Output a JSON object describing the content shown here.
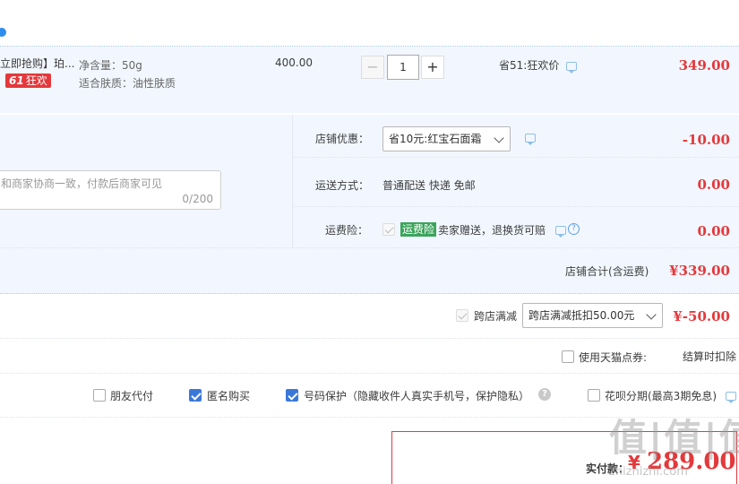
{
  "product": {
    "title": "立即抢购】珀...",
    "badge_number": "61",
    "badge_text": "狂欢",
    "net_content": "净含量：50g",
    "skin_type": "适合肤质：油性肤质",
    "unit_price": "400.00",
    "quantity": "1",
    "minus_label": "−",
    "plus_label": "+",
    "promo": "省51:狂欢价",
    "subtotal": "349.00"
  },
  "shop": {
    "coupon_label": "店铺优惠：",
    "coupon_select": "省10元:红宝石面霜",
    "coupon_amount": "-10.00",
    "shipping_label": "运送方式：",
    "shipping_value": "普通配送 快递 免邮",
    "shipping_amount": "0.00",
    "insurance_label": "运费险：",
    "insurance_tag": "运费险",
    "insurance_text": "卖家赠送，退换货可赔",
    "insurance_amount": "0.00",
    "message_placeholder": "和商家协商一致，付款后商家可见",
    "message_count": "0/200",
    "total_label": "店铺合计(含运费)",
    "total_amount": "¥339.00"
  },
  "cross_store": {
    "label": "跨店满减",
    "select": "跨店满减抵扣50.00元",
    "amount": "¥-50.00"
  },
  "tmall_points": {
    "label": "使用天猫点券:",
    "note": "结算时扣除"
  },
  "options": {
    "friend_pay": "朋友代付",
    "anonymous": "匿名购买",
    "number_protect": "号码保护（隐藏收件人真实手机号，保护隐私）",
    "huabei": "花呗分期(最高3期免息)"
  },
  "payment": {
    "label": "实付款：",
    "currency": "¥",
    "amount": "289.00"
  },
  "watermark": {
    "logo": "值|值|值",
    "url": "zhizhizhi.com"
  },
  "colors": {
    "accent_red": "#e4393c",
    "accent_blue": "#3a78d8",
    "panel_bg": "#f2f7ff"
  }
}
